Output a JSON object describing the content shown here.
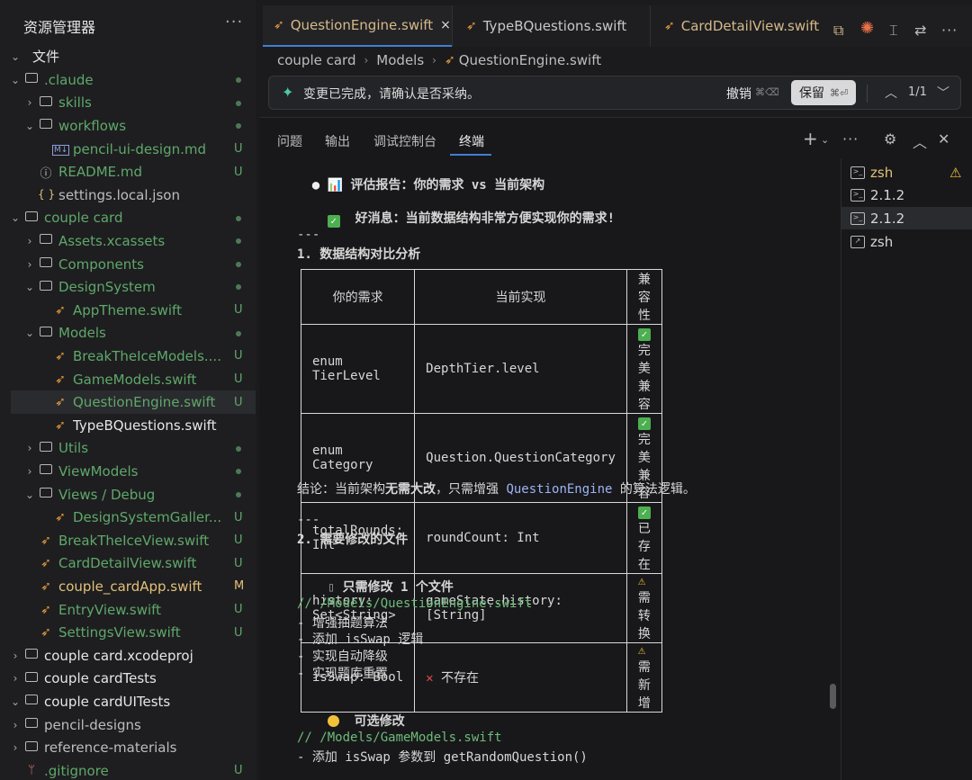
{
  "sidebar": {
    "title": "资源管理器",
    "more": "···",
    "root": "文件",
    "items": [
      {
        "label": ".claude",
        "status": "dot",
        "color": "#5fa86a"
      },
      {
        "label": "skills",
        "status": "dot",
        "color": "#5fa86a"
      },
      {
        "label": "workflows",
        "status": "dot",
        "color": "#5fa86a"
      },
      {
        "label": "pencil-ui-design.md",
        "status": "U",
        "color": "#5fa86a"
      },
      {
        "label": "README.md",
        "status": "U",
        "color": "#5fa86a"
      },
      {
        "label": "settings.local.json",
        "status": "",
        "color": "#bdbdbd"
      },
      {
        "label": "couple card",
        "status": "dot",
        "color": "#5fa86a"
      },
      {
        "label": "Assets.xcassets",
        "status": "dot",
        "color": "#5fa86a"
      },
      {
        "label": "Components",
        "status": "dot",
        "color": "#5fa86a"
      },
      {
        "label": "DesignSystem",
        "status": "dot",
        "color": "#5fa86a"
      },
      {
        "label": "AppTheme.swift",
        "status": "U",
        "color": "#5fa86a"
      },
      {
        "label": "Models",
        "status": "dot",
        "color": "#5fa86a"
      },
      {
        "label": "BreakTheIceModels....",
        "status": "U",
        "color": "#5fa86a"
      },
      {
        "label": "GameModels.swift",
        "status": "U",
        "color": "#5fa86a"
      },
      {
        "label": "QuestionEngine.swift",
        "status": "U",
        "color": "#5fa86a"
      },
      {
        "label": "TypeBQuestions.swift",
        "status": "",
        "color": "#e6e6e6"
      },
      {
        "label": "Utils",
        "status": "dot",
        "color": "#5fa86a"
      },
      {
        "label": "ViewModels",
        "status": "dot",
        "color": "#5fa86a"
      },
      {
        "label": "Views / Debug",
        "status": "dot",
        "color": "#5fa86a"
      },
      {
        "label": "DesignSystemGaller...",
        "status": "U",
        "color": "#5fa86a"
      },
      {
        "label": "BreakTheIceView.swift",
        "status": "U",
        "color": "#5fa86a"
      },
      {
        "label": "CardDetailView.swift",
        "status": "U",
        "color": "#5fa86a"
      },
      {
        "label": "couple_cardApp.swift",
        "status": "M",
        "color": "#e2c07a"
      },
      {
        "label": "EntryView.swift",
        "status": "U",
        "color": "#5fa86a"
      },
      {
        "label": "SettingsView.swift",
        "status": "U",
        "color": "#5fa86a"
      },
      {
        "label": "couple card.xcodeproj",
        "status": "",
        "color": "#e6e6e6"
      },
      {
        "label": "couple cardTests",
        "status": "",
        "color": "#e6e6e6"
      },
      {
        "label": "couple cardUITests",
        "status": "",
        "color": "#e6e6e6"
      },
      {
        "label": "pencil-designs",
        "status": "",
        "color": "#bdbdbd"
      },
      {
        "label": "reference-materials",
        "status": "",
        "color": "#bdbdbd"
      },
      {
        "label": ".gitignore",
        "status": "U",
        "color": "#5fa86a"
      }
    ]
  },
  "tabs": [
    {
      "label": "QuestionEngine.swift",
      "close": "×"
    },
    {
      "label": "TypeBQuestions.swift"
    },
    {
      "label": "CardDetailView.swift"
    }
  ],
  "breadcrumb": [
    "couple card",
    "Models",
    "QuestionEngine.swift"
  ],
  "banner": {
    "message": "变更已完成，请确认是否采纳。",
    "undo": "撤销",
    "undo_key": "⌘⌫",
    "keep": "保留",
    "keep_key": "⌘⏎",
    "counter": "1/1"
  },
  "panel": {
    "tabs": [
      "问题",
      "输出",
      "调试控制台",
      "终端"
    ],
    "add": "+"
  },
  "terminal": {
    "report_title": "📊 评估报告：你的需求 vs 当前架构",
    "good_news": "好消息：当前数据结构非常方便实现你的需求!",
    "sep1": "---",
    "section1": "1. 数据结构对比分析",
    "table_headers": [
      "你的需求",
      "当前实现",
      "兼容性"
    ],
    "table_rows": [
      [
        "enum TierLevel",
        "DepthTier.level",
        "完美兼容",
        "ok"
      ],
      [
        "enum Category",
        "Question.QuestionCategory",
        "完美兼容",
        "ok"
      ],
      [
        "totalRounds: Int",
        "roundCount: Int",
        "已存在",
        "ok"
      ],
      [
        "history: Set<String>",
        "gameState.history: [String]",
        "需转换",
        "warn"
      ],
      [
        "isSwap: Bool",
        "不存在",
        "需新增",
        "warn"
      ]
    ],
    "conclusion_prefix": "结论：当前架构",
    "conclusion_bold": "无需大改",
    "conclusion_mid": "，只需增强 ",
    "conclusion_code": "QuestionEngine",
    "conclusion_suffix": " 的算法逻辑。",
    "sep2": "---",
    "section2": "2. 需要修改的文件",
    "only_one": "只需修改 1 个文件",
    "comment1": "// /Models/QuestionEngine.swift",
    "bullets1": [
      "- 增强抽题算法",
      "- 添加 isSwap 逻辑",
      "- 实现自动降级",
      "- 实现题库重置"
    ],
    "optional": "可选修改",
    "comment2": "// /Models/GameModels.swift",
    "bullets2": [
      "- 添加 isSwap 参数到 getRandomQuestion()"
    ]
  },
  "terminals": [
    {
      "label": "zsh",
      "warn": true
    },
    {
      "label": "2.1.2"
    },
    {
      "label": "2.1.2"
    },
    {
      "label": "zsh"
    }
  ]
}
